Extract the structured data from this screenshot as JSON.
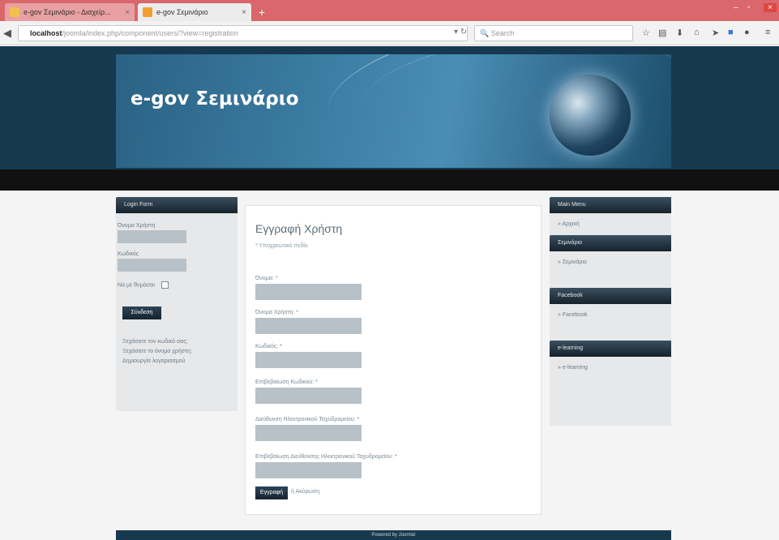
{
  "browser": {
    "tabs": [
      {
        "label": "e-gov Σεμινάριο - Διαχείρ..."
      },
      {
        "label": "e-gov Σεμινάριο"
      }
    ],
    "url_host": "localhost",
    "url_path": "/joomla/index.php/component/users/?view=registration",
    "search_placeholder": "Search"
  },
  "site": {
    "title": "e-gov Σεμινάριο"
  },
  "login_form": {
    "header": "Login Form",
    "username_label": "Όνομα Χρήστη",
    "password_label": "Κωδικός",
    "remember_label": "Να με θυμάσαι",
    "login_button": "Σύνδεση",
    "links": [
      "Ξεχάσατε τον κωδικό σας;",
      "Ξεχάσατε το όνομα χρήστη;",
      "Δημιουργία λογαριασμού"
    ]
  },
  "registration": {
    "title": "Εγγραφή Χρήστη",
    "required_note": "* Υποχρεωτικό πεδίο",
    "fields": [
      {
        "label": "Όνομα: *"
      },
      {
        "label": "Όνομα Χρήστη: *"
      },
      {
        "label": "Κωδικός: *"
      },
      {
        "label": "Επιβεβαίωση Κωδικού: *"
      },
      {
        "label": "Διεύθυνση Ηλεκτρονικού Ταχυδρομείου: *"
      },
      {
        "label": "Επιβεβαίωση Διεύθυνσης Ηλεκτρονικού Ταχυδρομείου: *"
      }
    ],
    "submit_button": "Εγγραφή",
    "cancel_link": "ή Ακύρωση"
  },
  "right_menus": [
    {
      "header": "Main Menu",
      "item": "Αρχική"
    },
    {
      "header": "Σεμινάριο",
      "item": "Σεμινάριο"
    },
    {
      "header": "Facebook",
      "item": "Facebook"
    },
    {
      "header": "e-learning",
      "item": "e-learning"
    }
  ],
  "footer": {
    "text": "Powered by Joomla!"
  }
}
